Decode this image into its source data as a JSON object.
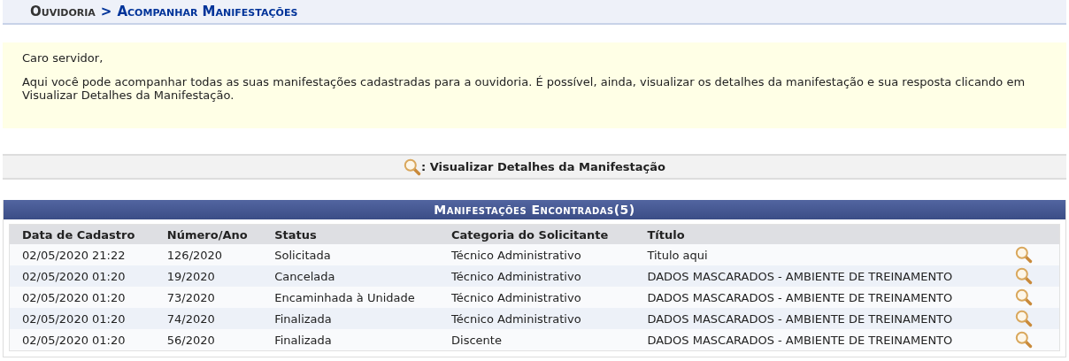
{
  "breadcrumb": {
    "section": "Ouvidoria",
    "separator": ">",
    "page": "Acompanhar Manifestações"
  },
  "notice": {
    "greeting": "Caro servidor,",
    "text": "Aqui você pode acompanhar todas as suas manifestações cadastradas para a ouvidoria. É possível, ainda, visualizar os detalhes da manifestação e sua resposta clicando em Visualizar Detalhes da Manifestação."
  },
  "legend": {
    "label": ": Visualizar Detalhes da Manifestação"
  },
  "table": {
    "title": "Manifestações Encontradas(5)",
    "columns": [
      "Data de Cadastro",
      "Número/Ano",
      "Status",
      "Categoria do Solicitante",
      "Título"
    ],
    "rows": [
      {
        "cells": [
          "02/05/2020 21:22",
          "126/2020",
          "Solicitada",
          "Técnico Administrativo",
          "Titulo aqui"
        ]
      },
      {
        "cells": [
          "02/05/2020 01:20",
          "19/2020",
          "Cancelada",
          "Técnico Administrativo",
          "DADOS MASCARADOS - AMBIENTE DE TREINAMENTO"
        ]
      },
      {
        "cells": [
          "02/05/2020 01:20",
          "73/2020",
          "Encaminhada à Unidade",
          "Técnico Administrativo",
          "DADOS MASCARADOS - AMBIENTE DE TREINAMENTO"
        ]
      },
      {
        "cells": [
          "02/05/2020 01:20",
          "74/2020",
          "Finalizada",
          "Técnico Administrativo",
          "DADOS MASCARADOS - AMBIENTE DE TREINAMENTO"
        ]
      },
      {
        "cells": [
          "02/05/2020 01:20",
          "56/2020",
          "Finalizada",
          "Discente",
          "DADOS MASCARADOS - AMBIENTE DE TREINAMENTO"
        ]
      }
    ]
  }
}
